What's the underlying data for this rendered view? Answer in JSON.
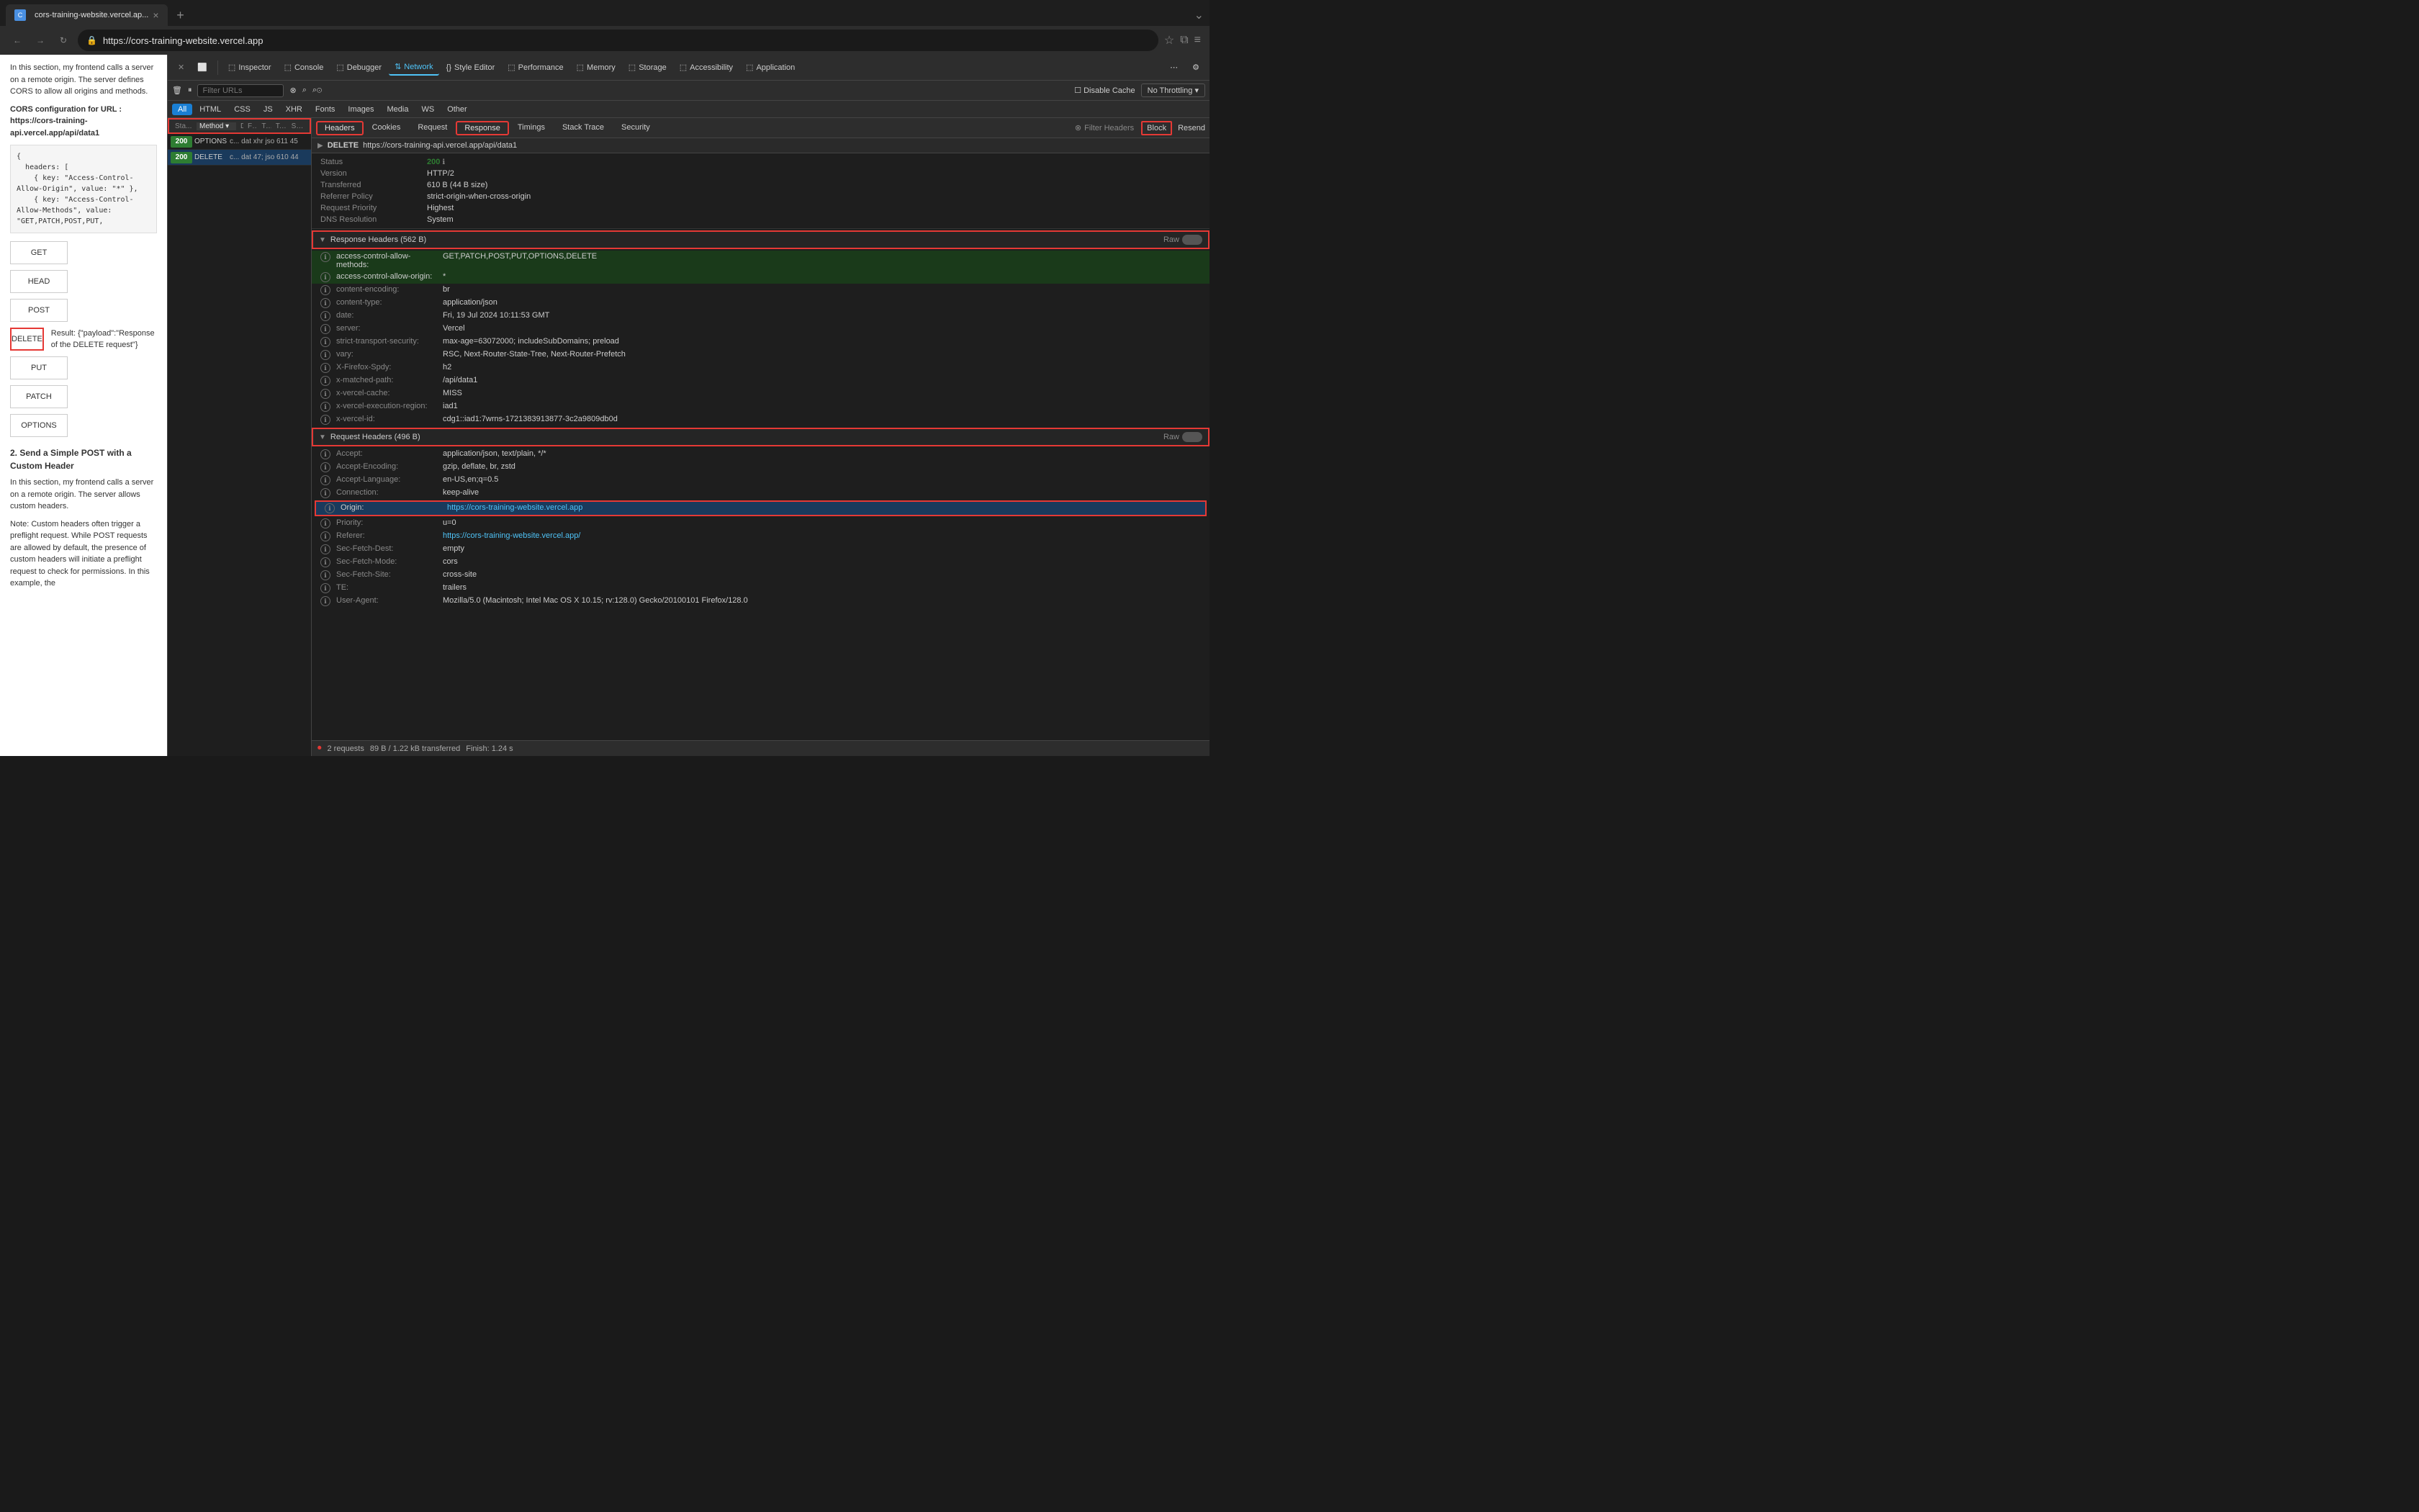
{
  "browser": {
    "tab_title": "cors-training-website.vercel.ap...",
    "url": "https://cors-training-website.vercel.app",
    "favicon": "C"
  },
  "devtools": {
    "tabs": [
      {
        "id": "inspector",
        "label": "Inspector",
        "icon": "⬚",
        "active": false
      },
      {
        "id": "console",
        "label": "Console",
        "icon": "⬚",
        "active": false
      },
      {
        "id": "debugger",
        "label": "Debugger",
        "icon": "⬚",
        "active": false
      },
      {
        "id": "network",
        "label": "Network",
        "icon": "⇅",
        "active": true
      },
      {
        "id": "style-editor",
        "label": "Style Editor",
        "icon": "{}",
        "active": false
      },
      {
        "id": "performance",
        "label": "Performance",
        "icon": "⬚",
        "active": false
      },
      {
        "id": "memory",
        "label": "Memory",
        "icon": "⬚",
        "active": false
      },
      {
        "id": "storage",
        "label": "Storage",
        "icon": "⬚",
        "active": false
      },
      {
        "id": "accessibility",
        "label": "Accessibility",
        "icon": "⬚",
        "active": false
      },
      {
        "id": "application",
        "label": "Application",
        "icon": "⬚",
        "active": false
      }
    ],
    "network": {
      "filter_placeholder": "Filter URLs",
      "filter_tabs": [
        "All",
        "HTML",
        "CSS",
        "JS",
        "XHR",
        "Fonts",
        "Images",
        "Media",
        "WS",
        "Other"
      ],
      "active_filter": "All",
      "options": {
        "disable_cache": "Disable Cache",
        "no_throttling": "No Throttling ▾"
      },
      "columns": [
        "Sta...",
        "Method",
        "Dom...",
        "Fil",
        "Ty",
        "T...",
        "Size"
      ],
      "requests": [
        {
          "status": "200",
          "method": "OPTIONS",
          "domain": "c...",
          "filetype": "dat",
          "type": "xhr",
          "size": "jso",
          "transferred": "611",
          "time": "45",
          "selected": false
        },
        {
          "status": "200",
          "method": "DELETE",
          "domain": "c...",
          "filetype": "dat",
          "type": "47",
          "size": "jso",
          "transferred": "610",
          "time": "44",
          "selected": true
        }
      ]
    },
    "request_details": {
      "url": "https://cors-training-api.vercel.app/api/data1",
      "method": "DELETE",
      "tabs": [
        "Headers",
        "Cookies",
        "Request",
        "Response",
        "Timings",
        "Stack Trace",
        "Security"
      ],
      "active_tab": "Headers",
      "highlighted_tab_response": "Response",
      "status": {
        "code": "200",
        "version": "HTTP/2",
        "transferred": "610 B (44 B size)",
        "referrer_policy": "strict-origin-when-cross-origin",
        "request_priority": "Highest",
        "dns_resolution": "System"
      },
      "response_headers": {
        "title": "Response Headers (562 B)",
        "raw": false,
        "headers": [
          {
            "key": "access-control-allow-methods:",
            "value": "GET,PATCH,POST,PUT,OPTIONS,DELETE",
            "highlighted": true
          },
          {
            "key": "access-control-allow-origin:",
            "value": "*",
            "highlighted": true
          },
          {
            "key": "content-encoding:",
            "value": "br"
          },
          {
            "key": "content-type:",
            "value": "application/json"
          },
          {
            "key": "date:",
            "value": "Fri, 19 Jul 2024 10:11:53 GMT"
          },
          {
            "key": "server:",
            "value": "Vercel"
          },
          {
            "key": "strict-transport-security:",
            "value": "max-age=63072000; includeSubDomains; preload"
          },
          {
            "key": "vary:",
            "value": "RSC, Next-Router-State-Tree, Next-Router-Prefetch"
          },
          {
            "key": "X-Firefox-Spdy:",
            "value": "h2"
          },
          {
            "key": "x-matched-path:",
            "value": "/api/data1"
          },
          {
            "key": "x-vercel-cache:",
            "value": "MISS"
          },
          {
            "key": "x-vercel-execution-region:",
            "value": "iad1"
          },
          {
            "key": "x-vercel-id:",
            "value": "cdg1::iad1:7wrns-1721383913877-3c2a9809db0d"
          }
        ]
      },
      "request_headers": {
        "title": "Request Headers (496 B)",
        "raw": false,
        "headers": [
          {
            "key": "Accept:",
            "value": "application/json, text/plain, */*"
          },
          {
            "key": "Accept-Encoding:",
            "value": "gzip, deflate, br, zstd"
          },
          {
            "key": "Accept-Language:",
            "value": "en-US,en;q=0.5"
          },
          {
            "key": "Connection:",
            "value": "keep-alive"
          },
          {
            "key": "Origin:",
            "value": "https://cors-training-website.vercel.app",
            "highlighted": true,
            "is_link": true
          },
          {
            "key": "Priority:",
            "value": "u=0"
          },
          {
            "key": "Referer:",
            "value": "https://cors-training-website.vercel.app/",
            "is_link": true
          },
          {
            "key": "Sec-Fetch-Dest:",
            "value": "empty"
          },
          {
            "key": "Sec-Fetch-Mode:",
            "value": "cors"
          },
          {
            "key": "Sec-Fetch-Site:",
            "value": "cross-site"
          },
          {
            "key": "TE:",
            "value": "trailers"
          },
          {
            "key": "User-Agent:",
            "value": "Mozilla/5.0 (Macintosh; Intel Mac OS X 10.15; rv:128.0) Gecko/20100101 Firefox/128.0"
          }
        ]
      }
    }
  },
  "webpage": {
    "intro_text": "In this section, my frontend calls a server on a remote origin. The server defines CORS to allow all origins and methods.",
    "cors_label": "CORS configuration for URL : https://cors-training-api.vercel.app/api/data1",
    "code": "{\n  headers: [\n    { key: \"Access-Control-Allow-Origin\", value: \"*\" },\n    { key: \"Access-Control-Allow-Methods\", value: \"GET,PATCH,POST,PUT,",
    "buttons": [
      {
        "label": "GET",
        "selected": false
      },
      {
        "label": "HEAD",
        "selected": false
      },
      {
        "label": "POST",
        "selected": false
      },
      {
        "label": "DELETE",
        "selected": true
      },
      {
        "label": "PUT",
        "selected": false
      },
      {
        "label": "PATCH",
        "selected": false
      },
      {
        "label": "OPTIONS",
        "selected": false
      }
    ],
    "delete_result": "Result: {\"payload\":\"Response of the DELETE request\"}",
    "section2_title": "2. Send a Simple POST with a Custom Header",
    "section2_text1": "In this section, my frontend calls a server on a remote origin. The server allows custom headers.",
    "section2_text2": "Note: Custom headers often trigger a preflight request. While POST requests are allowed by default, the presence of custom headers will initiate a preflight request to check for permissions. In this example, the"
  },
  "status_bar": {
    "requests": "2 requests",
    "transferred": "89 B / 1.22 kB transferred",
    "finish": "Finish: 1.24 s"
  },
  "icons": {
    "back": "←",
    "forward": "→",
    "reload": "↻",
    "lock": "🔒",
    "star": "☆",
    "extensions": "⧉",
    "menu": "≡",
    "close": "×",
    "chevron_down": "▾",
    "chevron_right": "▶",
    "filter": "⊗",
    "search": "⌕",
    "trash": "🗑",
    "pause": "⏸",
    "record": "⏺",
    "clear": "🚫",
    "info": "ℹ"
  }
}
